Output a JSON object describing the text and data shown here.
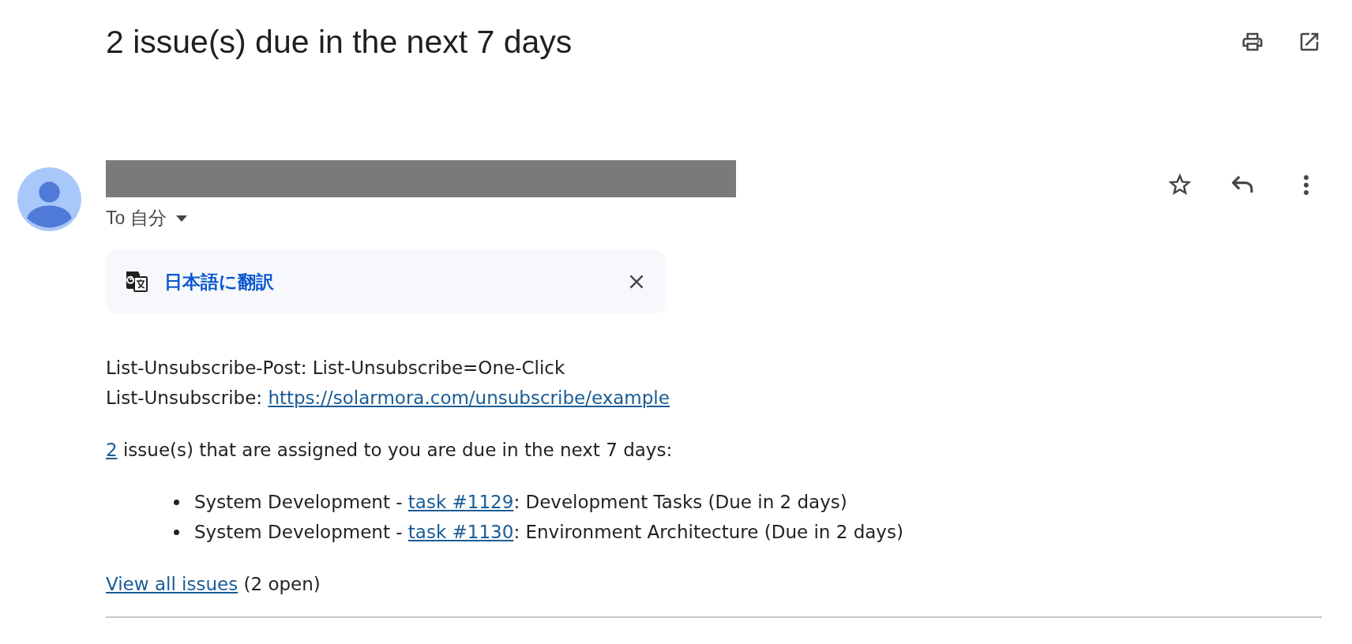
{
  "subject": "2 issue(s) due in the next 7 days",
  "message": {
    "starred": false,
    "recipient": "To 自分",
    "translate_label": "日本語に翻訳"
  },
  "body": {
    "headers": [
      [
        {
          "kind": "text",
          "text": "List-Unsubscribe-Post: List-Unsubscribe=One-Click"
        }
      ],
      [
        {
          "kind": "text",
          "text": "List-Unsubscribe: "
        },
        {
          "kind": "link",
          "text": "https://solarmora.com/unsubscribe/example"
        }
      ]
    ],
    "intro": [
      {
        "kind": "link",
        "text": "2"
      },
      {
        "kind": "text",
        "text": " issue(s) that are assigned to you are due in the next 7 days:"
      }
    ],
    "issues": [
      [
        {
          "kind": "text",
          "text": "System Development - "
        },
        {
          "kind": "link",
          "text": "task #1129"
        },
        {
          "kind": "text",
          "text": ": Development Tasks (Due in 2 days)"
        }
      ],
      [
        {
          "kind": "text",
          "text": "System Development - "
        },
        {
          "kind": "link",
          "text": "task #1130"
        },
        {
          "kind": "text",
          "text": ": Environment Architecture (Due in 2 days)"
        }
      ]
    ],
    "footer": [
      {
        "kind": "link",
        "text": "View all issues"
      },
      {
        "kind": "text",
        "text": " (2 open)"
      }
    ]
  }
}
